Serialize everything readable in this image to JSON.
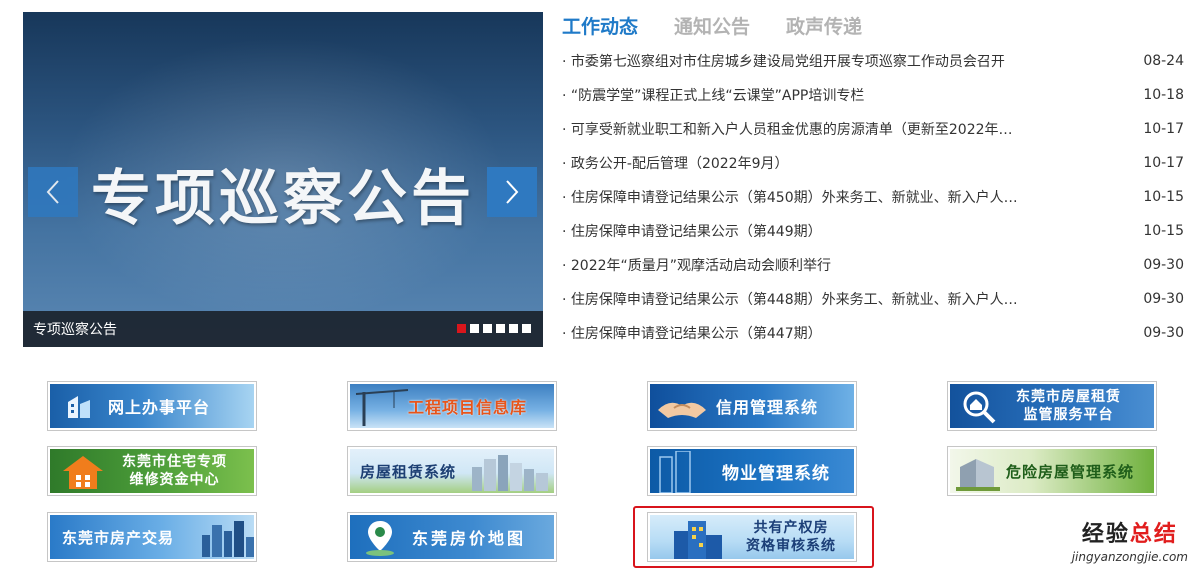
{
  "slider": {
    "heading": "专项巡察公告",
    "caption": "专项巡察公告",
    "dots": 6,
    "active_dot": 0
  },
  "tabs": [
    {
      "label": "工作动态",
      "active": true
    },
    {
      "label": "通知公告",
      "active": false
    },
    {
      "label": "政声传递",
      "active": false
    }
  ],
  "news": [
    {
      "title": "· 市委第七巡察组对市住房城乡建设局党组开展专项巡察工作动员会召开",
      "date": "08-24"
    },
    {
      "title": "· “防震学堂”课程正式上线“云课堂”APP培训专栏",
      "date": "10-18"
    },
    {
      "title": "· 可享受新就业职工和新入户人员租金优惠的房源清单（更新至2022年…",
      "date": "10-17"
    },
    {
      "title": "· 政务公开-配后管理（2022年9月）",
      "date": "10-17"
    },
    {
      "title": "· 住房保障申请登记结果公示（第450期）外来务工、新就业、新入户人…",
      "date": "10-15"
    },
    {
      "title": "· 住房保障申请登记结果公示（第449期）",
      "date": "10-15"
    },
    {
      "title": "· 2022年“质量月”观摩活动启动会顺利举行",
      "date": "09-30"
    },
    {
      "title": "· 住房保障申请登记结果公示（第448期）外来务工、新就业、新入户人…",
      "date": "09-30"
    },
    {
      "title": "· 住房保障申请登记结果公示（第447期）",
      "date": "09-30"
    }
  ],
  "banners": {
    "online_service": "网上办事平台",
    "project_db": "工程项目信息库",
    "credit": "信用管理系统",
    "rental_supervision_1": "东莞市房屋租赁",
    "rental_supervision_2": "监管服务平台",
    "maintenance_fund_1": "东莞市住宅专项",
    "maintenance_fund_2": "维修资金中心",
    "rental_system": "房屋租赁系统",
    "property_mgmt": "物业管理系统",
    "dangerous_housing": "危险房屋管理系统",
    "real_estate": "东莞市房产交易",
    "price_map": "东莞房价地图",
    "shared_property_1": "共有产权房",
    "shared_property_2": "资格审核系统"
  },
  "watermark": {
    "text_a": "经验",
    "text_b": "总结",
    "url": "jingyanzongjie.com"
  },
  "colors": {
    "accent": "#1f7ac8",
    "highlight": "#d8141c",
    "dot_active": "#d9161c"
  }
}
